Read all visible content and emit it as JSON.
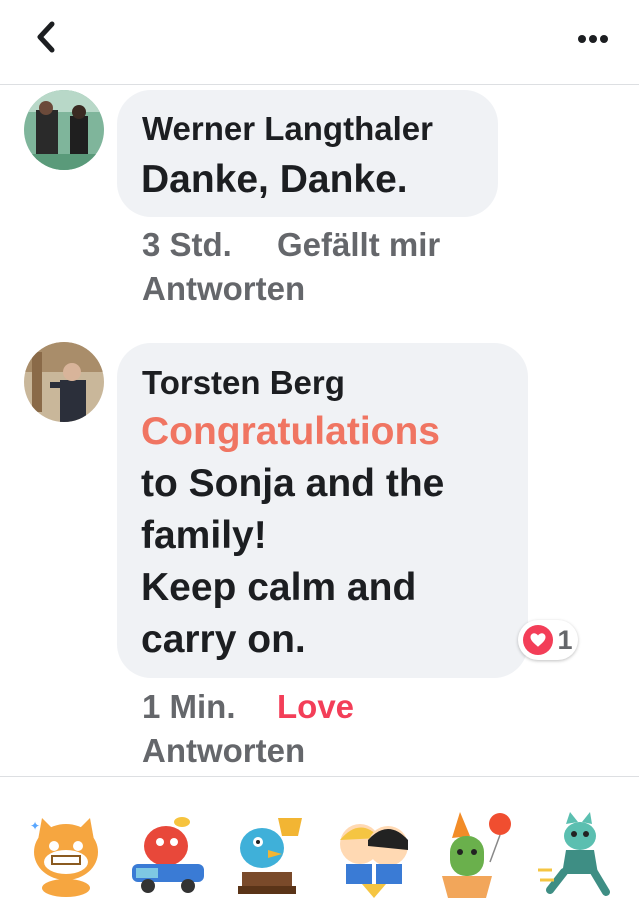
{
  "comments": [
    {
      "author": "Werner Langthaler",
      "text": "Danke, Danke.",
      "time": "3 Std.",
      "reaction_action": "Gefällt mir",
      "reply": "Antworten"
    },
    {
      "author": "Torsten Berg",
      "text_highlight": "Congratulations",
      "text_lines": [
        "to Sonja and the",
        "family!",
        "Keep calm and",
        "carry on."
      ],
      "time": "1 Min.",
      "reaction_action": "Love",
      "reply": "Antworten",
      "reaction_count": "1"
    }
  ],
  "colors": {
    "bubble": "#f0f2f5",
    "highlight": "#f07562",
    "love": "#f33e58",
    "meta": "#65676b"
  },
  "icons": {
    "back": "chevron-left-icon",
    "more": "more-horizontal-icon"
  },
  "stickers": [
    "cat-sticker",
    "dinosaur-car-sticker",
    "bird-trophy-sticker",
    "kids-hug-sticker",
    "cactus-party-sticker",
    "running-cat-sticker"
  ]
}
